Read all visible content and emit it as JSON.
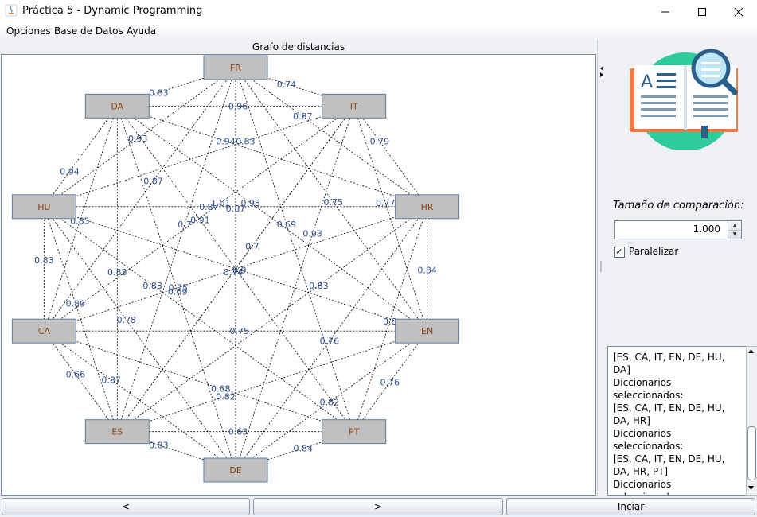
{
  "window": {
    "title": "Práctica 5 - Dynamic Programming"
  },
  "menu": [
    "Opciones",
    "Base de Datos",
    "Ayuda"
  ],
  "graph": {
    "title": "Grafo de distancias",
    "nodes": [
      "FR",
      "IT",
      "HR",
      "EN",
      "PT",
      "DE",
      "ES",
      "CA",
      "HU",
      "DA"
    ],
    "edges": [
      [
        "DA",
        "FR",
        "0.83"
      ],
      [
        "FR",
        "IT",
        "0.74"
      ],
      [
        "DA",
        "IT",
        "0.96"
      ],
      [
        "FR",
        "HR",
        "0.87"
      ],
      [
        "DA",
        "EN",
        "0.98"
      ],
      [
        "IT",
        "ES",
        "0.74"
      ],
      [
        "HU",
        "DA",
        "0.94"
      ],
      [
        "HU",
        "CA",
        "0.83"
      ],
      [
        "HR",
        "EN",
        "0.84"
      ],
      [
        "IT",
        "HR",
        "0.79"
      ],
      [
        "CA",
        "ES",
        "0.66"
      ],
      [
        "EN",
        "PT",
        "0.76"
      ],
      [
        "ES",
        "DE",
        "0.83"
      ],
      [
        "PT",
        "DE",
        "0.84"
      ],
      [
        "ES",
        "PT",
        "0.63"
      ],
      [
        "FR",
        "DE",
        "0.87"
      ],
      [
        "HU",
        "HR",
        "0.87"
      ],
      [
        "CA",
        "EN",
        "0.75"
      ],
      [
        "DA",
        "PT",
        "0.91"
      ],
      [
        "IT",
        "ES",
        "0.7"
      ],
      [
        "HU",
        "EN",
        "0.9"
      ],
      [
        "CA",
        "HR",
        "0.75"
      ],
      [
        "FR",
        "ES",
        "0.7"
      ],
      [
        "DA",
        "DE",
        "0.69"
      ],
      [
        "HU",
        "PT",
        "0.83"
      ],
      [
        "IT",
        "CA",
        "1.01"
      ],
      [
        "FR",
        "EN",
        "0.75"
      ],
      [
        "HR",
        "ES",
        "0.83"
      ],
      [
        "HU",
        "DE",
        "0.78"
      ],
      [
        "DA",
        "CA",
        "0.85"
      ],
      [
        "IT",
        "HU",
        "0.83"
      ],
      [
        "FR",
        "CA",
        "0.87"
      ],
      [
        "HR",
        "PT",
        "0.8"
      ],
      [
        "CA",
        "DE",
        "0.87"
      ],
      [
        "HU",
        "ES",
        "0.89"
      ],
      [
        "EN",
        "DE",
        "0.82"
      ],
      [
        "DA",
        "HR",
        "0.94"
      ],
      [
        "IT",
        "EN",
        "0.77"
      ],
      [
        "FR",
        "HU",
        "0.93"
      ],
      [
        "ES",
        "EN",
        "0.82"
      ],
      [
        "PT",
        "CA",
        "0.68"
      ],
      [
        "DA",
        "ES",
        "0.83"
      ],
      [
        "IT",
        "DE",
        "0.93"
      ],
      [
        "FR",
        "PT",
        "0.69"
      ],
      [
        "HR",
        "DE",
        "0.76"
      ]
    ]
  },
  "side": {
    "size_label": "Tamaño de comparación:",
    "size_value": "1.000",
    "parallel_label": "Paralelizar",
    "log": "[ES, CA, IT, EN, DE, HU, DA]\nDiccionarios seleccionados:\n[ES, CA, IT, EN, DE, HU, DA, HR]\nDiccionarios seleccionados:\n[ES, CA, IT, EN, DE, HU, DA, HR, PT]\nDiccionarios seleccionados:\n[ES, CA, IT, EN, DE, HU, DA, HR, PT, FR]"
  },
  "buttons": {
    "prev": "<",
    "next": ">",
    "start": "Inciar"
  },
  "colors": {
    "node_fill": "#c0c0c0",
    "node_label": "#8b4513",
    "edge_label": "#2f4f8f",
    "accent": "#2ecc9a"
  }
}
